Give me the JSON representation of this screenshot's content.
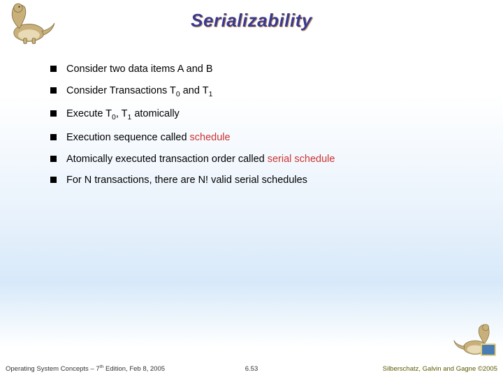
{
  "title": "Serializability",
  "bullets": [
    {
      "html": "Consider two data items A and B"
    },
    {
      "html": "Consider Transactions T<sub>0</sub> and T<sub>1</sub>"
    },
    {
      "html": "Execute T<sub>0</sub>, T<sub>1</sub> atomically"
    },
    {
      "html": "Execution sequence called <span class=\"red\">schedule</span>"
    },
    {
      "html": "Atomically executed transaction order called <span class=\"red\">serial schedule</span>"
    },
    {
      "html": "For N transactions, there are N! valid serial schedules"
    }
  ],
  "footer": {
    "left_a": "Operating System Concepts – 7",
    "left_sup": "th",
    "left_b": " Edition, Feb 8, 2005",
    "center": "6.53",
    "right": "Silberschatz, Galvin and Gagne ©2005"
  }
}
